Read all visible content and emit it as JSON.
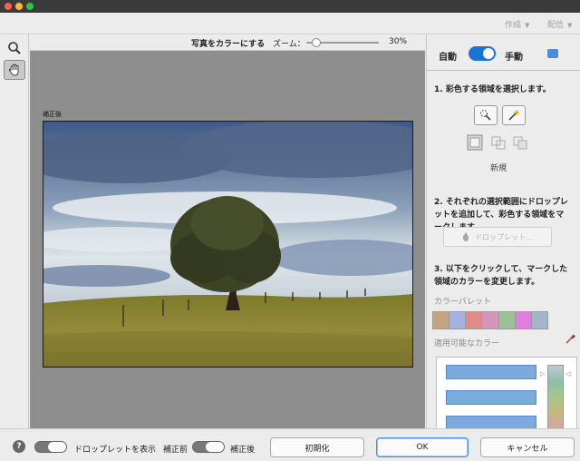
{
  "menu": {
    "create_label": "作成",
    "share_label": "配信"
  },
  "tools": [
    "zoom-tool",
    "hand-tool"
  ],
  "canvas": {
    "title": "写真をカラーにする",
    "zoom_label": "ズーム：",
    "zoom_value": "30%",
    "zoom_fraction": 0.3,
    "after_label": "補正後"
  },
  "panel": {
    "mode_auto": "自動",
    "mode_manual": "手動",
    "toggle_on": true,
    "step1": "1. 彩色する領域を選択します。",
    "new_label": "新規",
    "step2": "2. それぞれの選択範囲にドロップレットを追加して、彩色する領域をマークします。",
    "dropper_label": "ドロップレット...",
    "step3": "3. 以下をクリックして、マークした領域のカラーを変更します。",
    "palette_label": "カラーパレット",
    "palette_colors": [
      "#c4a484",
      "#a3b2e0",
      "#e08a8a",
      "#d496b8",
      "#9dc197",
      "#e07fe0",
      "#a3b5c9"
    ],
    "available_colors_label": "適用可能なカラー"
  },
  "footer": {
    "help": "?",
    "show_droplets": "ドロップレットを表示",
    "before": "補正前",
    "after": "補正後",
    "reset": "初期化",
    "ok": "OK",
    "cancel": "キャンセル"
  }
}
